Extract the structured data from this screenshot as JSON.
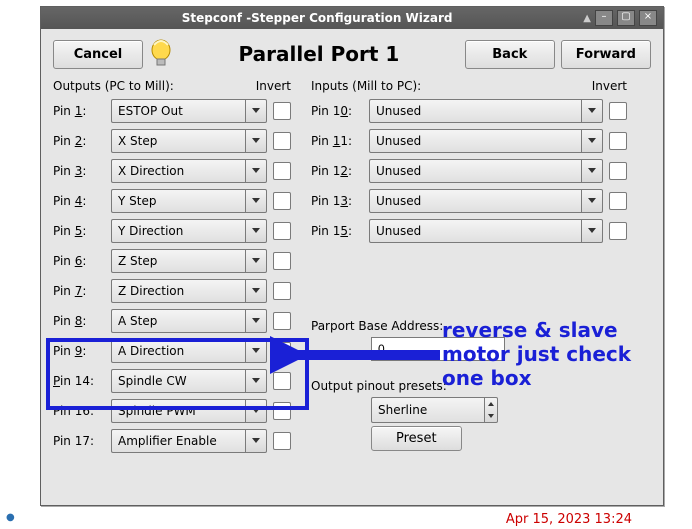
{
  "window": {
    "title": "Stepconf -Stepper Configuration Wizard"
  },
  "header": {
    "cancel": "Cancel",
    "page_title": "Parallel Port 1",
    "back": "Back",
    "forward": "Forward"
  },
  "outputs": {
    "header": "Outputs (PC to Mill):",
    "invert": "Invert",
    "pins": [
      {
        "pin": "1",
        "underline": "1",
        "label": "ESTOP Out"
      },
      {
        "pin": "2",
        "underline": "2",
        "label": "X Step"
      },
      {
        "pin": "3",
        "underline": "3",
        "label": "X Direction"
      },
      {
        "pin": "4",
        "underline": "4",
        "label": "Y Step"
      },
      {
        "pin": "5",
        "underline": "5",
        "label": "Y Direction"
      },
      {
        "pin": "6",
        "underline": "6",
        "label": "Z Step"
      },
      {
        "pin": "7",
        "underline": "7",
        "label": "Z Direction"
      },
      {
        "pin": "8",
        "underline": "8",
        "label": "A Step"
      },
      {
        "pin": "9",
        "underline": "9",
        "label": "A Direction"
      },
      {
        "pin": "14",
        "underline": "P",
        "label": "Spindle CW"
      },
      {
        "pin": "16",
        "underline": "",
        "label": "Spindle PWM"
      },
      {
        "pin": "17",
        "underline": "",
        "label": "Amplifier Enable"
      }
    ]
  },
  "inputs": {
    "header": "Inputs (Mill to PC):",
    "invert": "Invert",
    "pins": [
      {
        "pin": "10",
        "underline": "0",
        "label": "Unused"
      },
      {
        "pin": "11",
        "underline": "1",
        "label": "Unused"
      },
      {
        "pin": "12",
        "underline": "2",
        "label": "Unused"
      },
      {
        "pin": "13",
        "underline": "3",
        "label": "Unused"
      },
      {
        "pin": "15",
        "underline": "5",
        "label": "Unused"
      }
    ]
  },
  "parport": {
    "label": "Parport Base Address:",
    "value": "0"
  },
  "preset": {
    "label": "Output pinout presets:",
    "value": "Sherline",
    "button": "Preset"
  },
  "annotation": {
    "text": "reverse & slave motor just check one box"
  },
  "timestamp": "Apr 15, 2023 13:24"
}
